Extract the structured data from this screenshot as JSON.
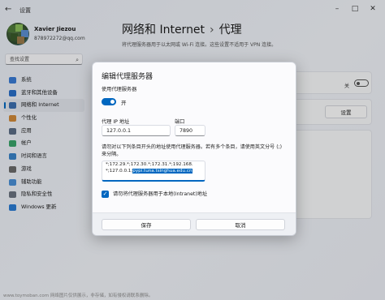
{
  "window": {
    "app_title": "设置"
  },
  "profile": {
    "name": "Xavier Jiezou",
    "email": "878972272@qq.com"
  },
  "search": {
    "placeholder": "查找设置"
  },
  "nav": {
    "items": [
      {
        "label": "系统",
        "color": "#3a7bd5"
      },
      {
        "label": "蓝牙和其他设备",
        "color": "#2a6fc9"
      },
      {
        "label": "网络和 Internet",
        "color": "#3d6fb0",
        "active": true
      },
      {
        "label": "个性化",
        "color": "#d08a3a"
      },
      {
        "label": "应用",
        "color": "#5b6d86"
      },
      {
        "label": "帐户",
        "color": "#3aa46a"
      },
      {
        "label": "时间和语言",
        "color": "#3a83c9"
      },
      {
        "label": "游戏",
        "color": "#6b6b6b"
      },
      {
        "label": "辅助功能",
        "color": "#4a90d6"
      },
      {
        "label": "隐私和安全性",
        "color": "#6b7380"
      },
      {
        "label": "Windows 更新",
        "color": "#2b7cd3"
      }
    ]
  },
  "header": {
    "crumb_parent": "网络和 Internet",
    "crumb_sep": "›",
    "crumb_current": "代理",
    "description": "将代理服务器用于以太网或 Wi-Fi 连接。这些设置不适用于 VPN 连接。"
  },
  "background": {
    "toggle_label": "关",
    "setup_button": "设置"
  },
  "dialog": {
    "title": "编辑代理服务器",
    "use_proxy_label": "使用代理服务器",
    "toggle_state": "开",
    "ip_label": "代理 IP 地址",
    "ip_value": "127.0.0.1",
    "port_label": "端口",
    "port_value": "7890",
    "help_text": "请勿对以下列条目开头的地址使用代理服务器。若有多个条目，请使用英文分号 (;) 来分隔。",
    "exceptions_lines": [
      "*;172.29.*;172.30.*;172.31.*;192.168.",
      "*;127.0.0.1;"
    ],
    "exceptions_selected": "pypi.tuna.tsinghua.edu.cn",
    "local_checkbox_label": "请勿将代理服务器用于本地(Intranet)地址",
    "save_label": "保存",
    "cancel_label": "取消"
  },
  "watermark": "www.toymoban.com 网络图片仅供展示，非存储，如有侵权请联系删除。",
  "colors": {
    "accent": "#0067c0"
  }
}
